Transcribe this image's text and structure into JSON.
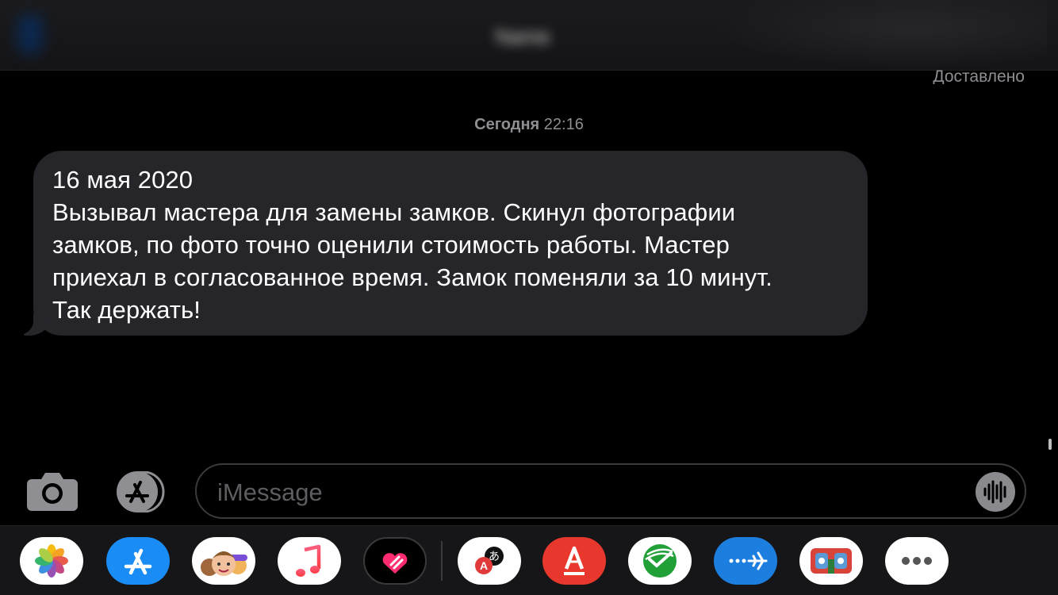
{
  "header": {
    "contact_name": "Name",
    "status_text": "Доставлено"
  },
  "timestamp": {
    "day": "Сегодня",
    "time": "22:16"
  },
  "message": {
    "lines": [
      "16 мая 2020",
      "Вызывал мастера для замены замков. Скинул фотографии",
      "замков, по фото точно оценили стоимость работы. Мастер",
      "приехал в согласованное время. Замок поменяли за 10 минут.",
      "Так держать!"
    ]
  },
  "input": {
    "placeholder": "iMessage",
    "value": ""
  },
  "icons": {
    "camera": "camera-icon",
    "app_store": "app-store-icon",
    "audio": "audio-waveform-icon"
  },
  "app_drawer": {
    "apps": [
      {
        "name": "photos-app-icon"
      },
      {
        "name": "app-store-app-icon"
      },
      {
        "name": "memoji-app-icon"
      },
      {
        "name": "music-app-icon"
      },
      {
        "name": "digital-touch-app-icon"
      },
      {
        "name": "translate-app-icon"
      },
      {
        "name": "alfa-bank-app-icon"
      },
      {
        "name": "sberbank-app-icon"
      },
      {
        "name": "messenger-plane-app-icon"
      },
      {
        "name": "stickers-app-icon"
      },
      {
        "name": "more-apps-icon"
      }
    ]
  },
  "colors": {
    "bubble": "#26252a",
    "background": "#000000",
    "secondary_text": "#8e8e93",
    "drawer": "#161618"
  }
}
